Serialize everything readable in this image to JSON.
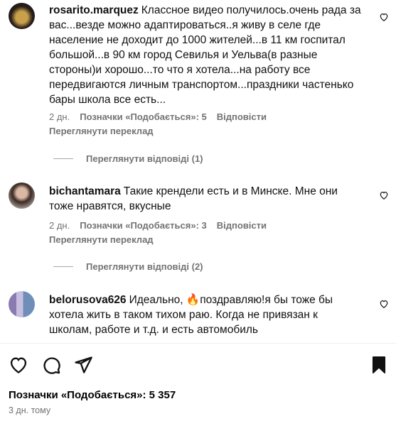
{
  "comments": [
    {
      "username": "rosarito.marquez",
      "text": "Классное видео получилось.очень рада за вас...везде можно адаптироваться..я живу в селе где население не доходит до 1000 жителей...в 11 км госпитал большой...в 90 км город Севилья и Уельва(в разные стороны)и хорошо...то что я хотела...на работу все передвигаются личным транспортом...праздники частенько бары школа все есть...",
      "age": "2 дн.",
      "likes": "Позначки «Подобається»: 5",
      "reply": "Відповісти",
      "translate": "Переглянути переклад",
      "view_replies": "Переглянути відповіді (1)"
    },
    {
      "username": "bichantamara",
      "text": "Такие крендели есть и в Минске. Мне они тоже нравятся, вкусные",
      "age": "2 дн.",
      "likes": "Позначки «Подобається»: 3",
      "reply": "Відповісти",
      "translate": "Переглянути переклад",
      "view_replies": "Переглянути відповіді (2)"
    },
    {
      "username": "belorusova626",
      "text_before": "Идеально, ",
      "emoji": "🔥",
      "text_after": "поздравляю!я бы тоже бы хотела жить в таком тихом раю. Когда не привязан к школам, работе и т.д. и есть автомобиль"
    }
  ],
  "footer": {
    "likes": "Позначки «Подобається»: 5 357",
    "date": "3 дн. тому"
  },
  "icons": {
    "like": "heart-icon",
    "comment": "comment-icon",
    "share": "paper-plane-icon",
    "save": "bookmark-icon"
  },
  "colors": {
    "secondary_text": "#737373",
    "divider": "#efefef"
  }
}
